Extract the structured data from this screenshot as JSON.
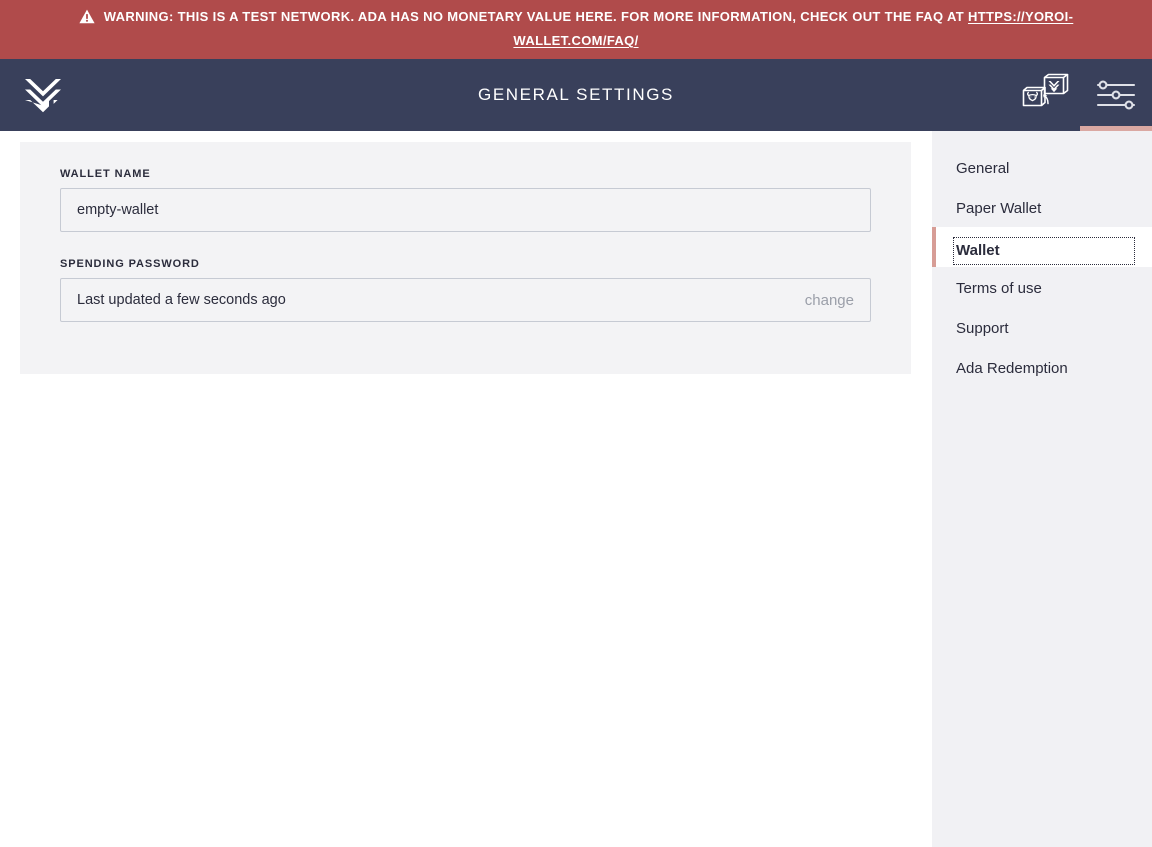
{
  "warning": {
    "icon": "warning-triangle-icon",
    "text_before_link": "WARNING: THIS IS A TEST NETWORK. ADA HAS NO MONETARY VALUE HERE. FOR MORE INFORMATION, CHECK OUT THE FAQ AT ",
    "link_text": "HTTPS://YOROI-WALLET.COM/FAQ/",
    "bg_color": "#b04b4b",
    "text_color": "#ffffff"
  },
  "navbar": {
    "logo_icon": "yoroi-chevron-logo-icon",
    "title": "GENERAL SETTINGS",
    "bg_color": "#39405b",
    "actions": [
      {
        "name": "wallet-switch-icon",
        "label": "Switch wallet",
        "active": false
      },
      {
        "name": "settings-sliders-icon",
        "label": "Settings",
        "active": true
      }
    ],
    "active_indicator_color": "#daa8a2"
  },
  "settings_form": {
    "wallet_name": {
      "label": "WALLET NAME",
      "value": "empty-wallet",
      "placeholder": "Wallet name"
    },
    "spending_password": {
      "label": "SPENDING PASSWORD",
      "status": "Last updated a few seconds ago",
      "action_label": "change"
    }
  },
  "settings_menu": {
    "items": [
      {
        "label": "General",
        "active": false
      },
      {
        "label": "Paper Wallet",
        "active": false
      },
      {
        "label": "Wallet",
        "active": true
      },
      {
        "label": "Terms of use",
        "active": false
      },
      {
        "label": "Support",
        "active": false
      },
      {
        "label": "Ada Redemption",
        "active": false
      }
    ],
    "active_accent_color": "#d79d96"
  }
}
